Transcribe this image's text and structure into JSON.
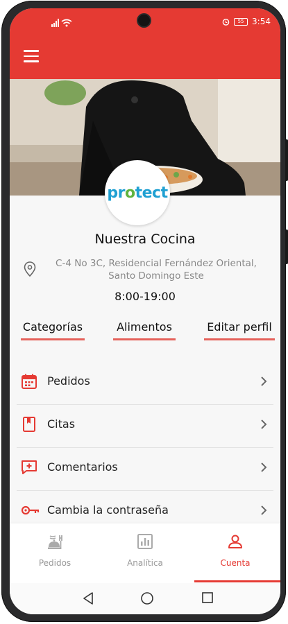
{
  "status_bar": {
    "time": "3:54",
    "battery": "55"
  },
  "header": {
    "menu_icon": "hamburger-icon"
  },
  "profile": {
    "logo_text_a": "pr",
    "logo_text_paw": "o",
    "logo_text_b": "tect",
    "name": "Nuestra Cocina",
    "address_line1": "C-4 No 3C, Residencial Fernández Oriental,",
    "address_line2": "Santo Domingo Este",
    "hours": "8:00-19:00"
  },
  "tabs": [
    {
      "label": "Categorías"
    },
    {
      "label": "Alimentos"
    },
    {
      "label": "Editar perfil"
    }
  ],
  "menu_items": [
    {
      "label": "Pedidos",
      "icon": "calendar-icon"
    },
    {
      "label": "Citas",
      "icon": "bookmark-icon"
    },
    {
      "label": "Comentarios",
      "icon": "comment-plus-icon"
    },
    {
      "label": "Cambia la contraseña",
      "icon": "key-icon"
    }
  ],
  "bottom_nav": [
    {
      "label": "Pedidos",
      "icon": "food-icon",
      "active": false
    },
    {
      "label": "Analítica",
      "icon": "chart-icon",
      "active": false
    },
    {
      "label": "Cuenta",
      "icon": "user-icon",
      "active": true
    }
  ],
  "colors": {
    "accent": "#e53a33",
    "tab_underline": "#e5615a",
    "logo_blue": "#1fa0d2",
    "logo_green": "#5fb33f"
  }
}
